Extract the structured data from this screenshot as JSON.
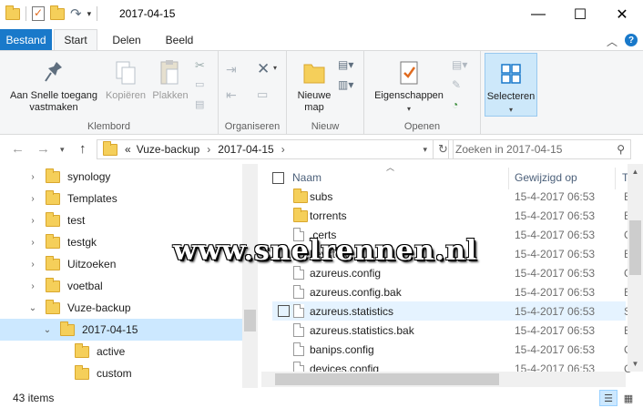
{
  "window": {
    "title": "2017-04-15"
  },
  "quick_access": [
    "folder-icon",
    "properties-icon",
    "new-folder-icon",
    "undo-icon"
  ],
  "tabs": {
    "file": "Bestand",
    "items": [
      "Start",
      "Delen",
      "Beeld"
    ],
    "active": "Start"
  },
  "ribbon": {
    "clipboard": {
      "label": "Klembord",
      "pin_label": "Aan Snelle toegang vastmaken",
      "copy_label": "Kopiëren",
      "paste_label": "Plakken"
    },
    "organize": {
      "label": "Organiseren"
    },
    "new": {
      "label": "Nieuw",
      "new_folder_label": "Nieuwe map"
    },
    "open": {
      "label": "Openen",
      "properties_label": "Eigenschappen"
    },
    "select": {
      "label": "Selecteren"
    }
  },
  "address": {
    "overflow": "«",
    "crumbs": [
      "Vuze-backup",
      "2017-04-15"
    ],
    "search_placeholder": "Zoeken in 2017-04-15"
  },
  "tree": [
    {
      "label": "synology",
      "expanded": false,
      "indent": 0
    },
    {
      "label": "Templates",
      "expanded": false,
      "indent": 0
    },
    {
      "label": "test",
      "expanded": false,
      "indent": 0
    },
    {
      "label": "testgk",
      "expanded": false,
      "indent": 0
    },
    {
      "label": "Uitzoeken",
      "expanded": false,
      "indent": 0
    },
    {
      "label": "voetbal",
      "expanded": false,
      "indent": 0
    },
    {
      "label": "Vuze-backup",
      "expanded": true,
      "indent": 0
    },
    {
      "label": "2017-04-15",
      "expanded": true,
      "indent": 1,
      "selected": true
    },
    {
      "label": "active",
      "expanded": null,
      "indent": 2
    },
    {
      "label": "custom",
      "expanded": null,
      "indent": 2
    }
  ],
  "columns": {
    "name": "Naam",
    "modified": "Gewijzigd op",
    "type": "T"
  },
  "files": [
    {
      "name": "subs",
      "date": "15-4-2017 06:53",
      "type": "B",
      "kind": "folder"
    },
    {
      "name": "torrents",
      "date": "15-4-2017 06:53",
      "type": "B",
      "kind": "folder"
    },
    {
      "name": ".certs",
      "date": "15-4-2017 06:53",
      "type": "C",
      "kind": "file"
    },
    {
      "name": "keystore",
      "date": "15-4-2017 06:53",
      "type": "B",
      "kind": "file"
    },
    {
      "name": "azureus.config",
      "date": "15-4-2017 06:53",
      "type": "C",
      "kind": "file"
    },
    {
      "name": "azureus.config.bak",
      "date": "15-4-2017 06:53",
      "type": "B",
      "kind": "file"
    },
    {
      "name": "azureus.statistics",
      "date": "15-4-2017 06:53",
      "type": "S",
      "kind": "file",
      "hover": true
    },
    {
      "name": "azureus.statistics.bak",
      "date": "15-4-2017 06:53",
      "type": "B",
      "kind": "file"
    },
    {
      "name": "banips.config",
      "date": "15-4-2017 06:53",
      "type": "C",
      "kind": "file"
    },
    {
      "name": "devices.config",
      "date": "15-4-2017 06:53",
      "type": "C",
      "kind": "file"
    }
  ],
  "status": {
    "count": "43 items"
  },
  "watermark": "www.snelrennen.nl",
  "colors": {
    "accent": "#1979ca",
    "selected": "#cce8ff",
    "hover": "#e5f3ff",
    "folder": "#f5cf5a"
  }
}
